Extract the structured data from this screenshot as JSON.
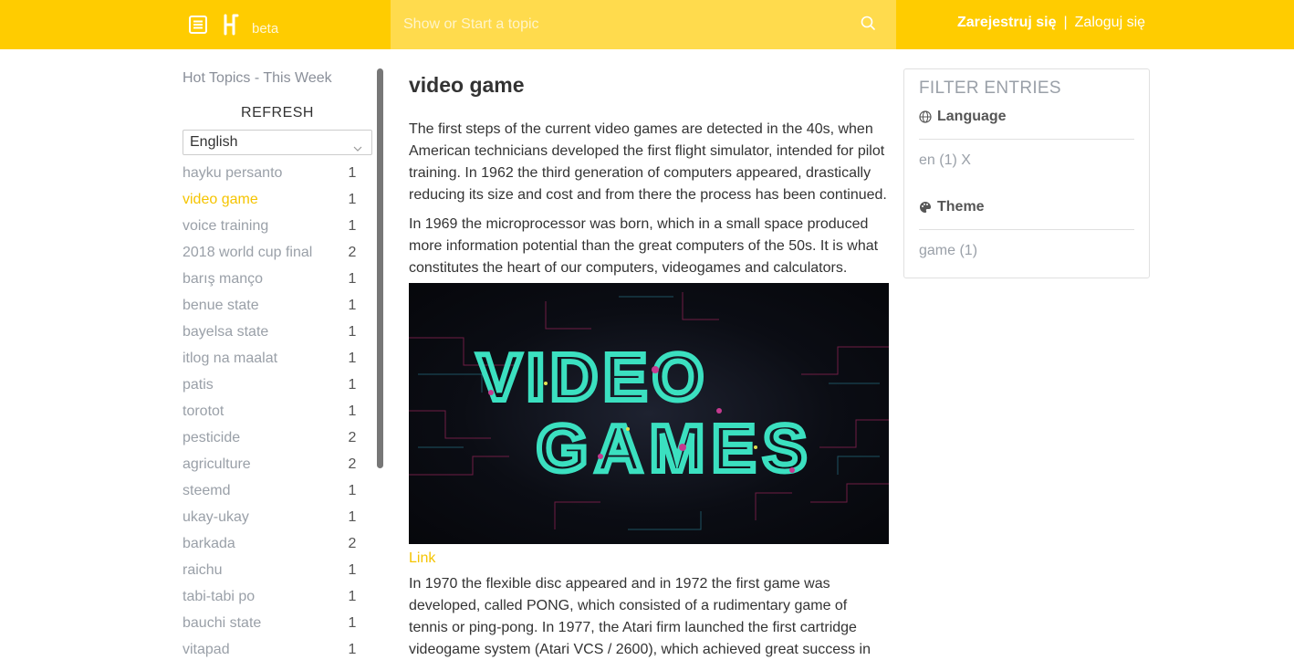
{
  "header": {
    "beta_label": "beta",
    "search_placeholder": "Show or Start a topic",
    "register_label": "Zarejestruj się",
    "separator": "|",
    "login_label": "Zaloguj się",
    "colors": {
      "brand": "#ffcc00",
      "search_bg": "#ffdb4d"
    },
    "icons": [
      "menu-icon",
      "brand-logo-icon",
      "search-icon"
    ]
  },
  "sidebar": {
    "title": "Hot Topics - This Week",
    "refresh_label": "REFRESH",
    "language_selected": "English",
    "topics": [
      {
        "label": "hayku persanto",
        "count": "1"
      },
      {
        "label": "video game",
        "count": "1"
      },
      {
        "label": "voice training",
        "count": "1"
      },
      {
        "label": "2018 world cup final",
        "count": "2"
      },
      {
        "label": "barış manço",
        "count": "1"
      },
      {
        "label": "benue state",
        "count": "1"
      },
      {
        "label": "bayelsa state",
        "count": "1"
      },
      {
        "label": "itlog na maalat",
        "count": "1"
      },
      {
        "label": "patis",
        "count": "1"
      },
      {
        "label": "torotot",
        "count": "1"
      },
      {
        "label": "pesticide",
        "count": "2"
      },
      {
        "label": "agriculture",
        "count": "2"
      },
      {
        "label": "steemd",
        "count": "1"
      },
      {
        "label": "ukay-ukay",
        "count": "1"
      },
      {
        "label": "barkada",
        "count": "2"
      },
      {
        "label": "raichu",
        "count": "1"
      },
      {
        "label": "tabi-tabi po",
        "count": "1"
      },
      {
        "label": "bauchi state",
        "count": "1"
      },
      {
        "label": "vitapad",
        "count": "1"
      }
    ],
    "active_topic": "video game"
  },
  "main": {
    "title": "video game",
    "paragraph_1": "The first steps of the current video games are detected in the 40s, when American technicians developed the first flight simulator, intended for pilot training. In 1962 the third generation of computers appeared, drastically reducing its size and cost and from there the process has been continued.",
    "paragraph_2": "In 1969 the microprocessor was born, which in a small space produced more information potential than the great computers of the 50s. It is what constitutes the heart of our computers, videogames and calculators.",
    "image_text_line1": "VIDEO",
    "image_text_line2": "GAMES",
    "link_label": "Link",
    "paragraph_3": "In 1970 the flexible disc appeared and in 1972 the first game was developed, called PONG, which consisted of a rudimentary game of tennis or ping-pong. In 1977, the Atari firm launched the first cartridge videogame system (Atari VCS / 2600), which achieved great success in"
  },
  "filter": {
    "title": "FILTER ENTRIES",
    "language_heading": "Language",
    "language_item": "en (1) X",
    "theme_heading": "Theme",
    "theme_item": "game (1)"
  }
}
